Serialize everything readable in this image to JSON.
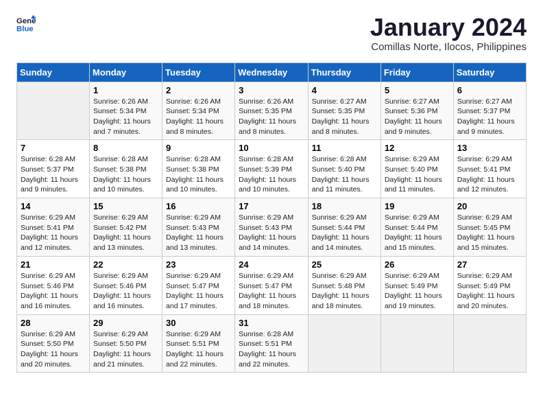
{
  "header": {
    "logo_line1": "General",
    "logo_line2": "Blue",
    "title": "January 2024",
    "subtitle": "Comillas Norte, Ilocos, Philippines"
  },
  "days_of_week": [
    "Sunday",
    "Monday",
    "Tuesday",
    "Wednesday",
    "Thursday",
    "Friday",
    "Saturday"
  ],
  "weeks": [
    [
      {
        "day": "",
        "empty": true
      },
      {
        "day": "1",
        "sunrise": "6:26 AM",
        "sunset": "5:34 PM",
        "daylight": "11 hours and 7 minutes."
      },
      {
        "day": "2",
        "sunrise": "6:26 AM",
        "sunset": "5:34 PM",
        "daylight": "11 hours and 8 minutes."
      },
      {
        "day": "3",
        "sunrise": "6:26 AM",
        "sunset": "5:35 PM",
        "daylight": "11 hours and 8 minutes."
      },
      {
        "day": "4",
        "sunrise": "6:27 AM",
        "sunset": "5:35 PM",
        "daylight": "11 hours and 8 minutes."
      },
      {
        "day": "5",
        "sunrise": "6:27 AM",
        "sunset": "5:36 PM",
        "daylight": "11 hours and 9 minutes."
      },
      {
        "day": "6",
        "sunrise": "6:27 AM",
        "sunset": "5:37 PM",
        "daylight": "11 hours and 9 minutes."
      }
    ],
    [
      {
        "day": "7",
        "sunrise": "6:28 AM",
        "sunset": "5:37 PM",
        "daylight": "11 hours and 9 minutes."
      },
      {
        "day": "8",
        "sunrise": "6:28 AM",
        "sunset": "5:38 PM",
        "daylight": "11 hours and 10 minutes."
      },
      {
        "day": "9",
        "sunrise": "6:28 AM",
        "sunset": "5:38 PM",
        "daylight": "11 hours and 10 minutes."
      },
      {
        "day": "10",
        "sunrise": "6:28 AM",
        "sunset": "5:39 PM",
        "daylight": "11 hours and 10 minutes."
      },
      {
        "day": "11",
        "sunrise": "6:28 AM",
        "sunset": "5:40 PM",
        "daylight": "11 hours and 11 minutes."
      },
      {
        "day": "12",
        "sunrise": "6:29 AM",
        "sunset": "5:40 PM",
        "daylight": "11 hours and 11 minutes."
      },
      {
        "day": "13",
        "sunrise": "6:29 AM",
        "sunset": "5:41 PM",
        "daylight": "11 hours and 12 minutes."
      }
    ],
    [
      {
        "day": "14",
        "sunrise": "6:29 AM",
        "sunset": "5:41 PM",
        "daylight": "11 hours and 12 minutes."
      },
      {
        "day": "15",
        "sunrise": "6:29 AM",
        "sunset": "5:42 PM",
        "daylight": "11 hours and 13 minutes."
      },
      {
        "day": "16",
        "sunrise": "6:29 AM",
        "sunset": "5:43 PM",
        "daylight": "11 hours and 13 minutes."
      },
      {
        "day": "17",
        "sunrise": "6:29 AM",
        "sunset": "5:43 PM",
        "daylight": "11 hours and 14 minutes."
      },
      {
        "day": "18",
        "sunrise": "6:29 AM",
        "sunset": "5:44 PM",
        "daylight": "11 hours and 14 minutes."
      },
      {
        "day": "19",
        "sunrise": "6:29 AM",
        "sunset": "5:44 PM",
        "daylight": "11 hours and 15 minutes."
      },
      {
        "day": "20",
        "sunrise": "6:29 AM",
        "sunset": "5:45 PM",
        "daylight": "11 hours and 15 minutes."
      }
    ],
    [
      {
        "day": "21",
        "sunrise": "6:29 AM",
        "sunset": "5:46 PM",
        "daylight": "11 hours and 16 minutes."
      },
      {
        "day": "22",
        "sunrise": "6:29 AM",
        "sunset": "5:46 PM",
        "daylight": "11 hours and 16 minutes."
      },
      {
        "day": "23",
        "sunrise": "6:29 AM",
        "sunset": "5:47 PM",
        "daylight": "11 hours and 17 minutes."
      },
      {
        "day": "24",
        "sunrise": "6:29 AM",
        "sunset": "5:47 PM",
        "daylight": "11 hours and 18 minutes."
      },
      {
        "day": "25",
        "sunrise": "6:29 AM",
        "sunset": "5:48 PM",
        "daylight": "11 hours and 18 minutes."
      },
      {
        "day": "26",
        "sunrise": "6:29 AM",
        "sunset": "5:49 PM",
        "daylight": "11 hours and 19 minutes."
      },
      {
        "day": "27",
        "sunrise": "6:29 AM",
        "sunset": "5:49 PM",
        "daylight": "11 hours and 20 minutes."
      }
    ],
    [
      {
        "day": "28",
        "sunrise": "6:29 AM",
        "sunset": "5:50 PM",
        "daylight": "11 hours and 20 minutes."
      },
      {
        "day": "29",
        "sunrise": "6:29 AM",
        "sunset": "5:50 PM",
        "daylight": "11 hours and 21 minutes."
      },
      {
        "day": "30",
        "sunrise": "6:29 AM",
        "sunset": "5:51 PM",
        "daylight": "11 hours and 22 minutes."
      },
      {
        "day": "31",
        "sunrise": "6:28 AM",
        "sunset": "5:51 PM",
        "daylight": "11 hours and 22 minutes."
      },
      {
        "day": "",
        "empty": true
      },
      {
        "day": "",
        "empty": true
      },
      {
        "day": "",
        "empty": true
      }
    ]
  ],
  "labels": {
    "sunrise": "Sunrise:",
    "sunset": "Sunset:",
    "daylight": "Daylight:"
  }
}
